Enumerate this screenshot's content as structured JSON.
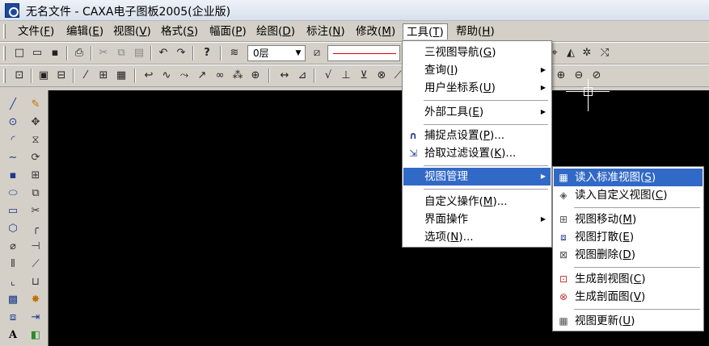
{
  "window": {
    "title": "无名文件 - CAXA电子图板2005(企业版)"
  },
  "menubar": {
    "items": [
      {
        "label": "文件",
        "key": "F"
      },
      {
        "label": "编辑",
        "key": "E"
      },
      {
        "label": "视图",
        "key": "V"
      },
      {
        "label": "格式",
        "key": "S"
      },
      {
        "label": "幅面",
        "key": "P"
      },
      {
        "label": "绘图",
        "key": "D"
      },
      {
        "label": "标注",
        "key": "N"
      },
      {
        "label": "修改",
        "key": "M"
      },
      {
        "label": "工具",
        "key": "T"
      },
      {
        "label": "帮助",
        "key": "H"
      }
    ]
  },
  "toolbar": {
    "layer_value": "0层"
  },
  "tools_menu": {
    "items": [
      {
        "label": "三视图导航",
        "key": "G",
        "suffix": ""
      },
      {
        "label": "查询",
        "key": "I",
        "suffix": ""
      },
      {
        "label": "用户坐标系",
        "key": "U",
        "suffix": ""
      },
      {
        "label": "外部工具",
        "key": "E",
        "suffix": ""
      },
      {
        "label": "捕捉点设置",
        "key": "P",
        "suffix": "..."
      },
      {
        "label": "拾取过滤设置",
        "key": "K",
        "suffix": "..."
      },
      {
        "label": "视图管理",
        "key": "",
        "suffix": ""
      },
      {
        "label": "自定义操作",
        "key": "M",
        "suffix": "..."
      },
      {
        "label": "界面操作",
        "key": "",
        "suffix": ""
      },
      {
        "label": "选项",
        "key": "N",
        "suffix": "..."
      }
    ]
  },
  "view_menu": {
    "items": [
      {
        "label": "读入标准视图",
        "key": "S"
      },
      {
        "label": "读入自定义视图",
        "key": "C"
      },
      {
        "label": "视图移动",
        "key": "M"
      },
      {
        "label": "视图打散",
        "key": "E"
      },
      {
        "label": "视图删除",
        "key": "D"
      },
      {
        "label": "生成剖视图",
        "key": "C"
      },
      {
        "label": "生成剖面图",
        "key": "V"
      },
      {
        "label": "视图更新",
        "key": "U"
      }
    ]
  },
  "colors": {
    "highlight": "#3169c6",
    "canvas": "#000000",
    "chrome": "#d4d0c8"
  }
}
